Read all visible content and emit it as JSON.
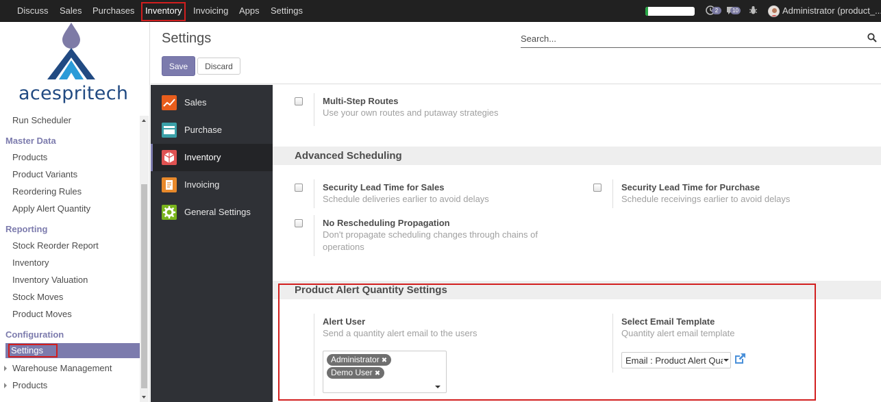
{
  "topbar": {
    "menu": [
      "Discuss",
      "Sales",
      "Purchases",
      "Inventory",
      "Invoicing",
      "Apps",
      "Settings"
    ],
    "active": "Inventory",
    "activity_count": "2",
    "message_count": "10",
    "user": "Administrator (product_..."
  },
  "sidebar": {
    "logo_text": "acespritech",
    "top_item": "Run Scheduler",
    "sections": [
      {
        "title": "Master Data",
        "items": [
          "Products",
          "Product Variants",
          "Reordering Rules",
          "Apply Alert Quantity"
        ]
      },
      {
        "title": "Reporting",
        "items": [
          "Stock Reorder Report",
          "Inventory",
          "Inventory Valuation",
          "Stock Moves",
          "Product Moves"
        ]
      },
      {
        "title": "Configuration",
        "items": [
          "Settings",
          "Warehouse Management",
          "Products"
        ]
      }
    ],
    "selected": "Settings"
  },
  "control_panel": {
    "title": "Settings",
    "search_placeholder": "Search...",
    "save": "Save",
    "discard": "Discard"
  },
  "apps": [
    {
      "label": "Sales",
      "color": "#e85d1c"
    },
    {
      "label": "Purchase",
      "color": "#3aa0a8"
    },
    {
      "label": "Inventory",
      "color": "#e05252"
    },
    {
      "label": "Invoicing",
      "color": "#e8892b"
    },
    {
      "label": "General Settings",
      "color": "#7ab51d"
    }
  ],
  "active_app": "Inventory",
  "settings": {
    "multi_step": {
      "title": "Multi-Step Routes",
      "desc": "Use your own routes and putaway strategies"
    },
    "advanced_scheduling": {
      "title": "Advanced Scheduling",
      "lead_sales": {
        "title": "Security Lead Time for Sales",
        "desc": "Schedule deliveries earlier to avoid delays"
      },
      "lead_purchase": {
        "title": "Security Lead Time for Purchase",
        "desc": "Schedule receivings earlier to avoid delays"
      },
      "no_reschedule": {
        "title": "No Rescheduling Propagation",
        "desc": "Don't propagate scheduling changes through chains of operations"
      }
    },
    "product_alert": {
      "title": "Product Alert Quantity Settings",
      "alert_user": {
        "title": "Alert User",
        "desc": "Send a quantity alert email to the users",
        "tags": [
          "Administrator",
          "Demo User"
        ]
      },
      "email_template": {
        "title": "Select Email Template",
        "desc": "Quantity alert email template",
        "value": "Email : Product Alert Quantity"
      }
    }
  }
}
